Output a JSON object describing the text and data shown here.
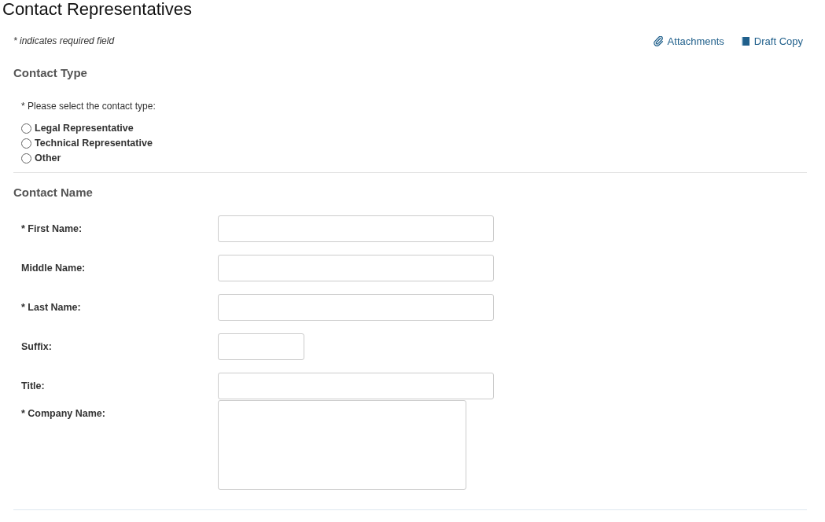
{
  "page_title": "Contact Representatives",
  "required_note": "* indicates required field",
  "links": [
    {
      "label": "Attachments",
      "kind": "paperclip"
    },
    {
      "label": "Draft Copy",
      "kind": "book"
    }
  ],
  "contact_type": {
    "heading": "Contact Type",
    "prompt": "* Please select the contact type:",
    "options": [
      {
        "label": "Legal Representative",
        "selected": false
      },
      {
        "label": "Technical Representative",
        "selected": false
      },
      {
        "label": "Other",
        "selected": false
      }
    ]
  },
  "contact_name": {
    "heading": "Contact Name",
    "fields": [
      {
        "label": "* First Name:",
        "kind": "text"
      },
      {
        "label": "Middle Name:",
        "kind": "text"
      },
      {
        "label": "* Last Name:",
        "kind": "text"
      },
      {
        "label": "Suffix:",
        "kind": "short"
      },
      {
        "label": "Title:",
        "kind": "text"
      },
      {
        "label": "* Company Name:",
        "kind": "textarea"
      }
    ]
  }
}
